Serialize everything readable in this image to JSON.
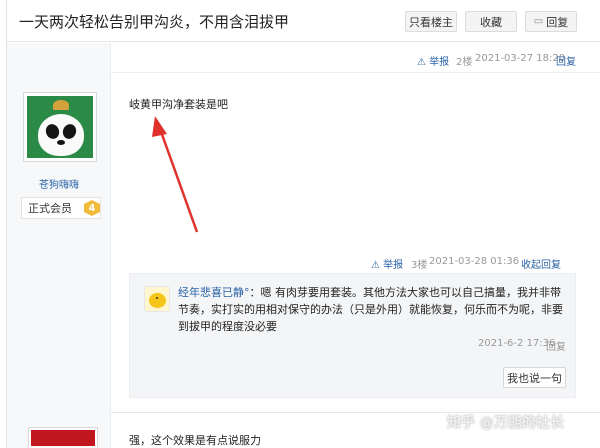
{
  "thread": {
    "title": "一天两次轻松告别甲沟炎，不用含泪拔甲",
    "btn_only_op": "只看楼主",
    "btn_favorite": "收藏",
    "btn_reply": "回复"
  },
  "prev_post_meta": {
    "report": "举报",
    "floor": "2楼",
    "time": "2021-03-27 18:20",
    "reply": "回复"
  },
  "post": {
    "author": "苍狗嗨嗨",
    "rank_label": "正式会员",
    "rank_level": "4",
    "content": "岐黄甲沟净套装是吧",
    "report": "举报",
    "floor": "3楼",
    "time": "2021-03-28 01:36",
    "collapse_reply": "收起回复"
  },
  "reply": {
    "user": "经年悲喜已静°",
    "text": "：嗯 有肉芽要用套装。其他方法大家也可以自己搞量，我并非带节奏，实打实的用相对保守的办法（只是外用）就能恢复，何乐而不为呢，非要到拔甲的程度没必要",
    "time": "2021-6-2 17:36",
    "reply": "回复",
    "say_button": "我也说一句"
  },
  "next_post": {
    "content": "强，这个效果是有点说服力"
  },
  "watermark": "知乎 @万能的社长",
  "colors": {
    "link": "#2b63a6",
    "arrow": "#e0322c",
    "avatar_bg": "#2b8a45"
  }
}
